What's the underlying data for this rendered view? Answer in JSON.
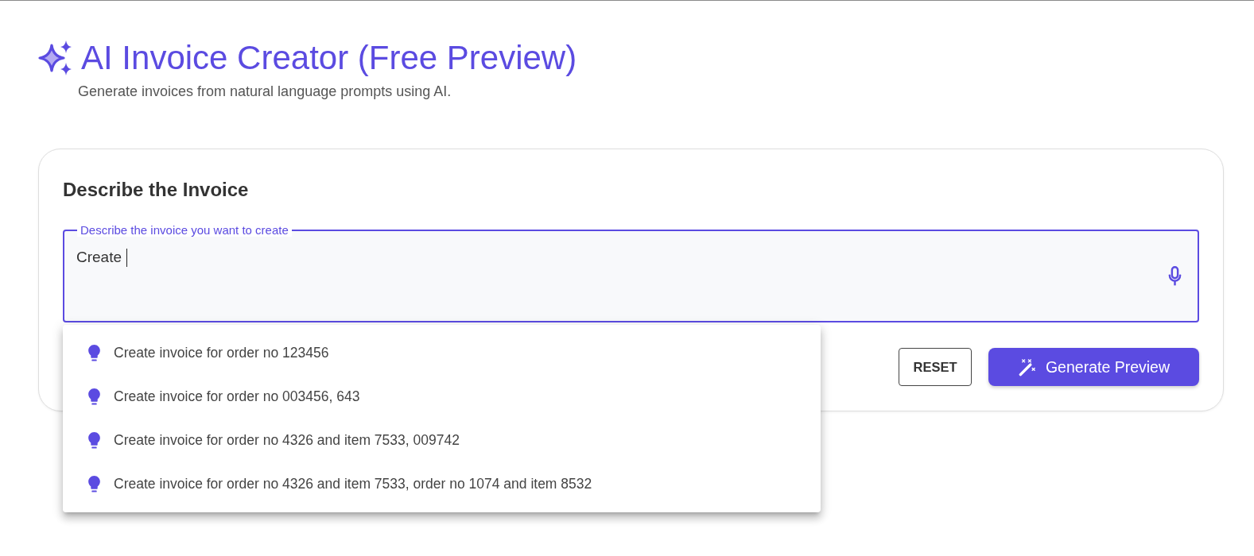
{
  "header": {
    "title": "AI Invoice Creator (Free Preview)",
    "subtitle": "Generate invoices from natural language prompts using AI."
  },
  "card": {
    "heading": "Describe the Invoice",
    "prompt_field": {
      "label": "Describe the invoice you want to create",
      "value": "Create",
      "focused": true
    },
    "suggestions": [
      {
        "text": "Create invoice for order no 123456",
        "selected": false
      },
      {
        "text": "Create invoice for order no 003456, 643",
        "selected": false
      },
      {
        "text": "Create invoice for order no 4326 and item 7533, 009742",
        "selected": false
      },
      {
        "text": "Create invoice for order no 4326 and item 7533, order no 1074 and item 8532",
        "selected": false
      }
    ],
    "buttons": [
      {
        "label": "RESET",
        "kind": "outlined"
      },
      {
        "label": "Generate Preview",
        "kind": "primary"
      }
    ]
  }
}
